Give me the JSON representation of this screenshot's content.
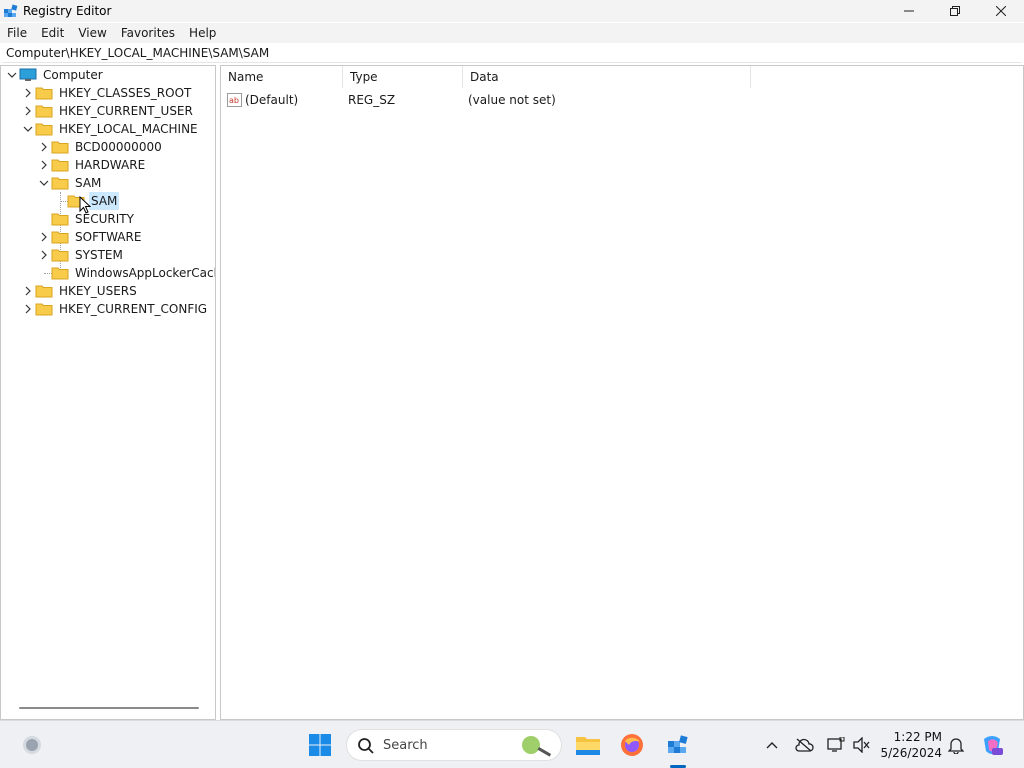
{
  "window": {
    "title": "Registry Editor"
  },
  "menu": [
    "File",
    "Edit",
    "View",
    "Favorites",
    "Help"
  ],
  "address": "Computer\\HKEY_LOCAL_MACHINE\\SAM\\SAM",
  "tree": {
    "root": "Computer",
    "hkcr": "HKEY_CLASSES_ROOT",
    "hkcu": "HKEY_CURRENT_USER",
    "hklm": "HKEY_LOCAL_MACHINE",
    "bcd": "BCD00000000",
    "hardware": "HARDWARE",
    "sam": "SAM",
    "sam_child": "SAM",
    "security": "SECURITY",
    "software": "SOFTWARE",
    "system": "SYSTEM",
    "applocker": "WindowsAppLockerCache",
    "hku": "HKEY_USERS",
    "hkcc": "HKEY_CURRENT_CONFIG"
  },
  "list": {
    "headers": {
      "name": "Name",
      "type": "Type",
      "data": "Data"
    },
    "rows": [
      {
        "name": "(Default)",
        "type": "REG_SZ",
        "data": "(value not set)"
      }
    ]
  },
  "taskbar": {
    "search_placeholder": "Search",
    "time": "1:22 PM",
    "date": "5/26/2024"
  },
  "colors": {
    "accent": "#0067c0",
    "folder": "#f8cc4a",
    "selection": "#cce8ff"
  }
}
